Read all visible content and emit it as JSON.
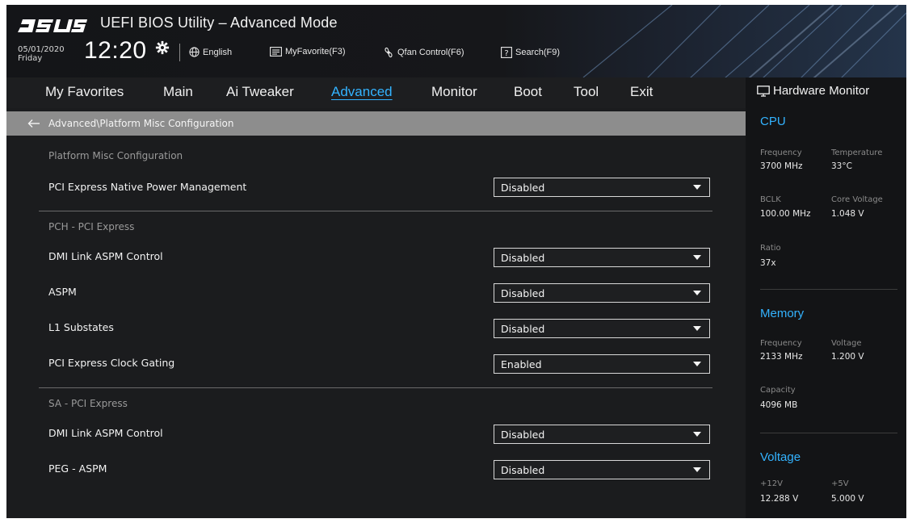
{
  "header": {
    "title": "UEFI BIOS Utility – Advanced Mode",
    "date": "05/01/2020",
    "day": "Friday",
    "time": "12:20",
    "tools": {
      "language": "English",
      "favorites": "MyFavorite(F3)",
      "qfan": "Qfan Control(F6)",
      "search": "Search(F9)"
    }
  },
  "menu": {
    "tabs": [
      {
        "label": "My Favorites"
      },
      {
        "label": "Main"
      },
      {
        "label": "Ai Tweaker"
      },
      {
        "label": "Advanced"
      },
      {
        "label": "Monitor"
      },
      {
        "label": "Boot"
      },
      {
        "label": "Tool"
      },
      {
        "label": "Exit"
      }
    ],
    "active": "Advanced"
  },
  "breadcrumb": "Advanced\\Platform Misc Configuration",
  "content": {
    "sections": {
      "platform": "Platform Misc Configuration",
      "pch": "PCH - PCI Express",
      "sa": "SA - PCI Express"
    },
    "settings": [
      {
        "label": "PCI Express Native Power Management",
        "value": "Disabled"
      },
      {
        "label": "DMI Link ASPM Control",
        "value": "Disabled"
      },
      {
        "label": "ASPM",
        "value": "Disabled"
      },
      {
        "label": "L1 Substates",
        "value": "Disabled"
      },
      {
        "label": "PCI Express Clock Gating",
        "value": "Enabled"
      },
      {
        "label": "DMI Link ASPM Control",
        "value": "Disabled"
      },
      {
        "label": "PEG - ASPM",
        "value": "Disabled"
      }
    ]
  },
  "hardware_monitor": {
    "title": "Hardware Monitor",
    "cpu": {
      "heading": "CPU",
      "frequency_label": "Frequency",
      "frequency": "3700 MHz",
      "temperature_label": "Temperature",
      "temperature": "33°C",
      "bclk_label": "BCLK",
      "bclk": "100.00 MHz",
      "core_voltage_label": "Core Voltage",
      "core_voltage": "1.048 V",
      "ratio_label": "Ratio",
      "ratio": "37x"
    },
    "memory": {
      "heading": "Memory",
      "frequency_label": "Frequency",
      "frequency": "2133 MHz",
      "voltage_label": "Voltage",
      "voltage": "1.200 V",
      "capacity_label": "Capacity",
      "capacity": "4096 MB"
    },
    "voltage": {
      "heading": "Voltage",
      "v12_label": "+12V",
      "v12": "12.288 V",
      "v5_label": "+5V",
      "v5": "5.000 V"
    }
  },
  "colors": {
    "accent": "#33b3ff",
    "breadcrumb_bg": "#8d8d8d",
    "panel_bg": "#1b1c1e",
    "monitor_bg": "#131416"
  }
}
